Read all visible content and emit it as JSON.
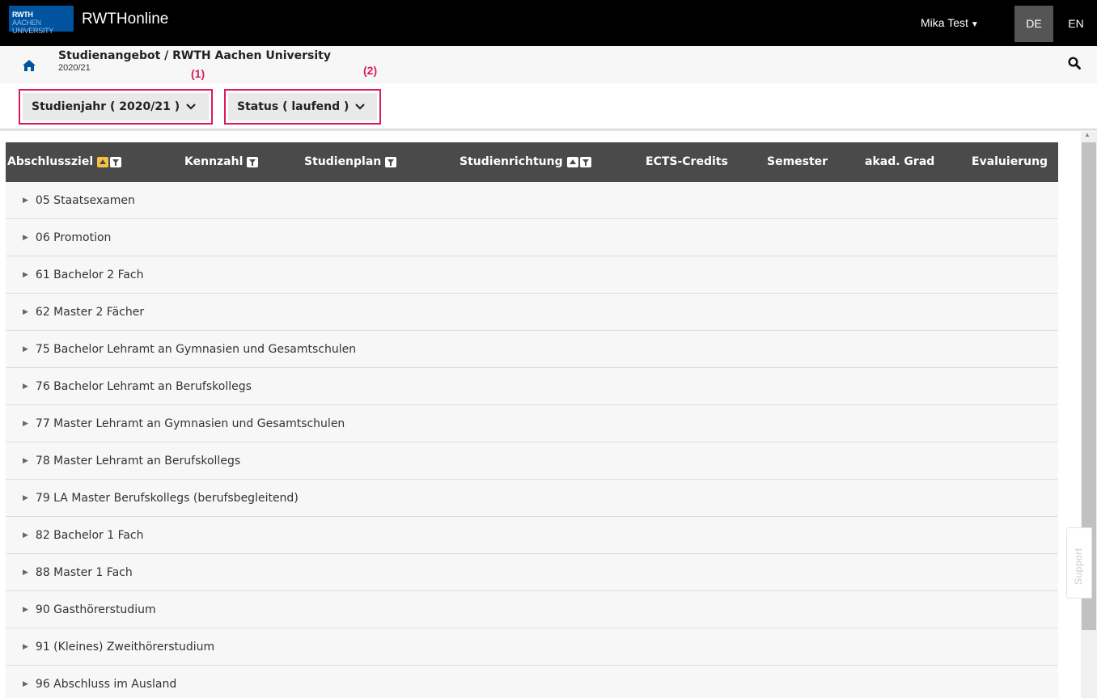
{
  "app": {
    "logo_main": "RWTH",
    "logo_sub": "AACHEN UNIVERSITY",
    "name": "RWTHonline"
  },
  "topbar": {
    "user": "Mika Test",
    "lang_de": "DE",
    "lang_en": "EN"
  },
  "header": {
    "title": "Studienangebot / RWTH Aachen University",
    "subtitle": "2020/21"
  },
  "annotations": {
    "one": "(1)",
    "two": "(2)"
  },
  "filters": {
    "year": "Studienjahr ( 2020/21 )",
    "status": "Status ( laufend )"
  },
  "table": {
    "columns": [
      "Abschlussziel",
      "Kennzahl",
      "Studienplan",
      "Studienrichtung",
      "ECTS-Credits",
      "Semester",
      "akad. Grad",
      "Evaluierung"
    ],
    "rows": [
      "05 Staatsexamen",
      "06 Promotion",
      "61 Bachelor 2 Fach",
      "62 Master 2 Fächer",
      "75 Bachelor Lehramt an Gymnasien und Gesamtschulen",
      "76 Bachelor Lehramt an Berufskollegs",
      "77 Master Lehramt an Gymnasien und Gesamtschulen",
      "78 Master Lehramt an Berufskollegs",
      "79 LA Master Berufskollegs (berufsbegleitend)",
      "82 Bachelor 1 Fach",
      "88 Master 1 Fach",
      "90 Gasthörerstudium",
      "91 (Kleines) Zweithörerstudium",
      "96 Abschluss im Ausland"
    ]
  },
  "support": "Support",
  "colors": {
    "accent_highlight": "#d81b60",
    "header_bg": "#4a4a4a",
    "topbar_bg": "#000000",
    "brand_blue": "#00549f",
    "sort_active": "#f5c242"
  },
  "icons": {
    "home": "home-icon",
    "search": "search-icon",
    "chevron": "chevron-down-icon",
    "expand": "triangle-right-icon"
  }
}
